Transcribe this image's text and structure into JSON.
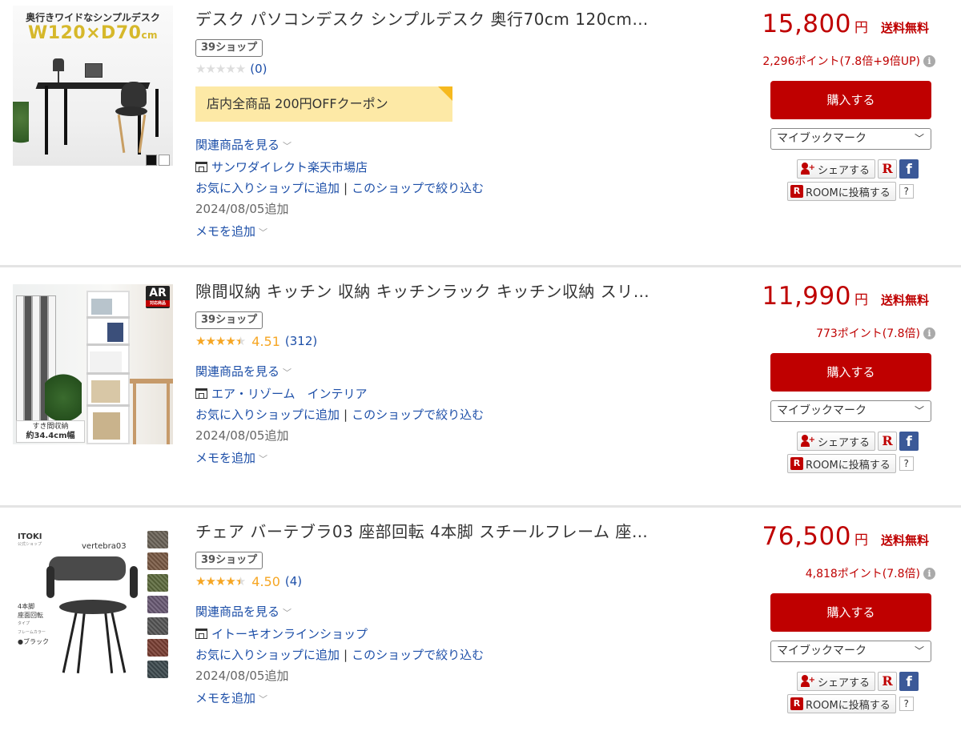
{
  "colors": {
    "accent": "#bf0000",
    "link": "#1d4fa8",
    "star": "#f6a623",
    "coupon_bg": "#fde9a6"
  },
  "labels": {
    "shop_badge": "39ショップ",
    "related": "関連商品を見る",
    "favorite": "お気に入りショップに追加",
    "filter_shop": "このショップで絞り込む",
    "memo": "メモを追加",
    "yen": "円",
    "shipping": "送料無料",
    "buy": "購入する",
    "bookmark": "マイブックマーク",
    "share": "シェアする",
    "room": "ROOMに投稿する",
    "help": "?",
    "r_icon": "R",
    "fb_icon": "f"
  },
  "items": [
    {
      "title": "デスク パソコンデスク シンプルデスク 奥行70cm 120cm…",
      "stars": 0,
      "rating_avg": "",
      "rating_count": "(0)",
      "coupon": "店内全商品 200円OFFクーポン",
      "shop": "サンワダイレクト楽天市場店",
      "added": "2024/08/05追加",
      "price": "15,800",
      "points": "2,296ポイント(7.8倍+9倍UP)",
      "thumb": {
        "header": "奥行きワイドなシンプルデスク",
        "size": "W120×D70",
        "size_unit": "cm"
      }
    },
    {
      "title": "隙間収納 キッチン 収納 キッチンラック キッチン収納 スリ…",
      "stars": 4.5,
      "rating_avg": "4.51",
      "rating_count": "(312)",
      "coupon": "",
      "shop": "エア・リゾーム　インテリア",
      "added": "2024/08/05追加",
      "price": "11,990",
      "points": "773ポイント(7.8倍)",
      "thumb": {
        "ar": "AR",
        "ar_sub": "対応商品",
        "label_top": "すき間収納",
        "label_bottom": "約34.4cm幅"
      }
    },
    {
      "title": "チェア バーテブラ03 座部回転 4本脚 スチールフレーム 座…",
      "stars": 4.5,
      "rating_avg": "4.50",
      "rating_count": "(4)",
      "coupon": "",
      "shop": "イトーキオンラインショップ",
      "added": "2024/08/05追加",
      "price": "76,500",
      "points": "4,818ポイント(7.8倍)",
      "thumb": {
        "logo": "ITOKI",
        "logo_sub": "公式ショップ",
        "brand": "vertebra03",
        "line1": "4本脚",
        "line2": "座面回転",
        "line3": "タイプ",
        "frame_label": "フレームカラー",
        "frame_color": "●ブラック"
      }
    }
  ]
}
